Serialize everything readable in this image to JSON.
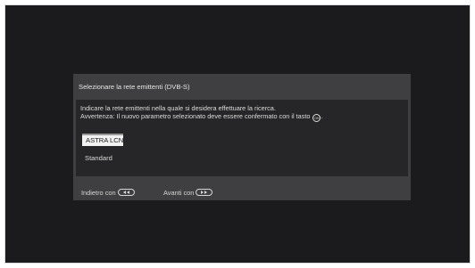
{
  "dialog": {
    "title": "Selezionare la rete emittenti (DVB-S)",
    "message_line1": "Indicare la rete emittenti nella quale si desidera effettuare la ricerca.",
    "message_line2": "Avvertenza: Il nuovo parametro selezionato deve essere confermato con il tasto",
    "ok_icon_label": "OK",
    "options": [
      {
        "label": "ASTRA LCN",
        "selected": true
      },
      {
        "label": "Standard",
        "selected": false
      }
    ]
  },
  "footer": {
    "back_label": "Indietro con",
    "back_icon": "rewind-key-icon",
    "forward_label": "Avanti con",
    "forward_icon": "fast-forward-key-icon"
  },
  "colors": {
    "screen_background": "#1b1a1d",
    "dialog_frame": "#3f3f42",
    "dialog_body": "#262628",
    "selected_option": "#f2f2f2"
  }
}
